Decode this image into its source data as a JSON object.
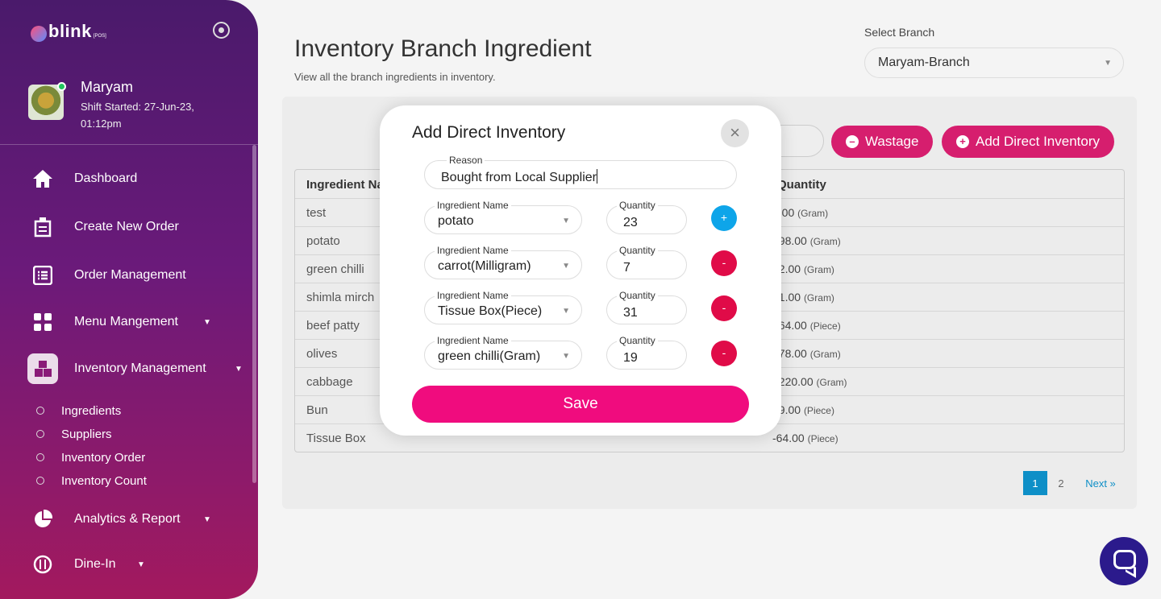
{
  "app": {
    "logo_text": "blink",
    "logo_sub": "[POS]"
  },
  "profile": {
    "name": "Maryam",
    "shift": "Shift Started: 27-Jun-23, 01:12pm"
  },
  "sidebar": {
    "items": [
      {
        "label": "Dashboard",
        "icon": "home-icon"
      },
      {
        "label": "Create New Order",
        "icon": "receipt-icon"
      },
      {
        "label": "Order Management",
        "icon": "list-icon"
      },
      {
        "label": "Menu Mangement",
        "icon": "grid-icon"
      },
      {
        "label": "Inventory Management",
        "icon": "boxes-icon"
      },
      {
        "label": "Analytics & Report",
        "icon": "pie-chart-icon"
      },
      {
        "label": "Dine-In",
        "icon": "dine-icon"
      }
    ],
    "sub_items": [
      "Ingredients",
      "Suppliers",
      "Inventory Order",
      "Inventory Count"
    ]
  },
  "page": {
    "title": "Inventory Branch Ingredient",
    "subtitle": "View all the branch ingredients in inventory.",
    "branch_label": "Select Branch",
    "branch_value": "Maryam-Branch",
    "wastage_label": "Wastage",
    "add_direct_label": "Add Direct Inventory"
  },
  "table": {
    "headers": [
      "Ingredient Na",
      "Quantity"
    ],
    "rows": [
      {
        "name": "test",
        "qty": "0.00",
        "unit": "(Gram)"
      },
      {
        "name": "potato",
        "qty": "998.00",
        "unit": "(Gram)"
      },
      {
        "name": "green chilli",
        "qty": "92.00",
        "unit": "(Gram)"
      },
      {
        "name": "shimla mirch",
        "qty": "91.00",
        "unit": "(Gram)"
      },
      {
        "name": "beef patty",
        "qty": "364.00",
        "unit": "(Piece)"
      },
      {
        "name": "olives",
        "qty": "278.00",
        "unit": "(Gram)"
      },
      {
        "name": "cabbage",
        "qty": "2220.00",
        "unit": "(Gram)"
      },
      {
        "name": "Bun",
        "qty": "49.00",
        "unit": "(Piece)"
      },
      {
        "name": "Tissue Box",
        "qty": "-64.00",
        "unit": "(Piece)"
      }
    ]
  },
  "pagination": {
    "current": "1",
    "page2": "2",
    "next": "Next »"
  },
  "modal": {
    "title": "Add Direct Inventory",
    "close": "×",
    "reason_label": "Reason",
    "reason_value": "Bought from Local Supplier",
    "ingredient_label": "Ingredient Name",
    "quantity_label": "Quantity",
    "rows": [
      {
        "ingredient": "potato",
        "quantity": "23",
        "action": "+"
      },
      {
        "ingredient": "carrot(Milligram)",
        "quantity": "7",
        "action": "-"
      },
      {
        "ingredient": "Tissue Box(Piece)",
        "quantity": "31",
        "action": "-"
      },
      {
        "ingredient": "green chilli(Gram)",
        "quantity": "19",
        "action": "-"
      }
    ],
    "save_label": "Save"
  },
  "colors": {
    "accent": "#f00c7e",
    "brand": "#d61e6e",
    "add": "#0ea5e9",
    "remove": "#e00b48"
  }
}
